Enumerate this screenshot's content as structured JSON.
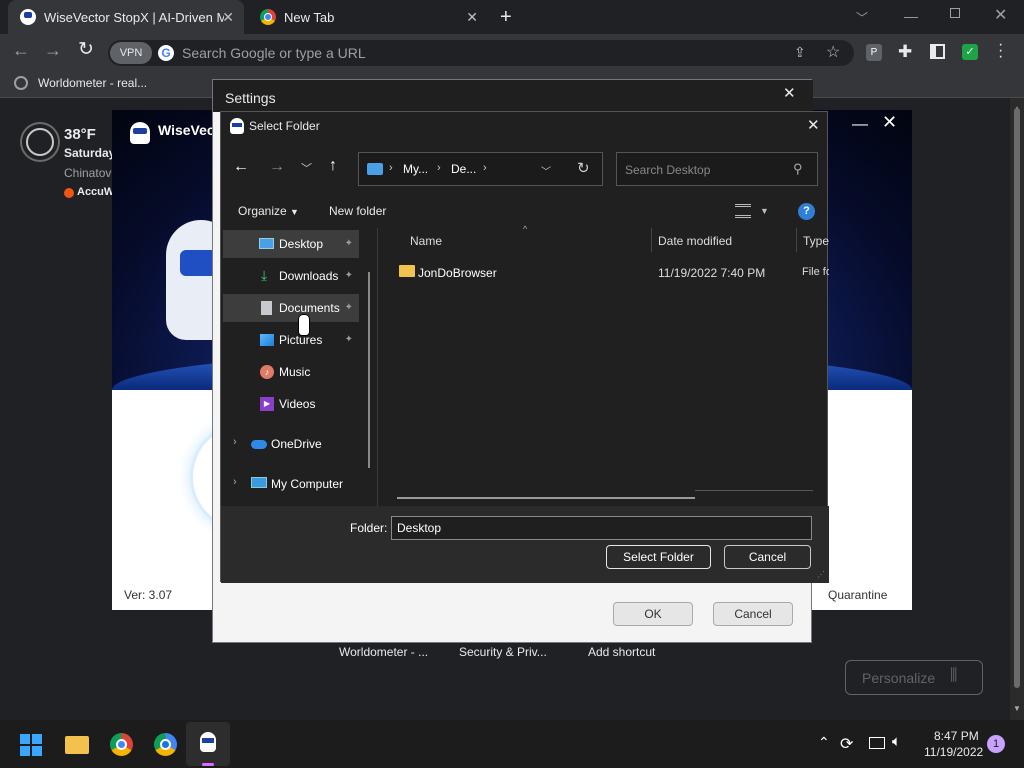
{
  "browser": {
    "tabs": [
      {
        "title": "WiseVector StopX | AI-Driven Ma"
      },
      {
        "title": "New Tab"
      }
    ],
    "address_placeholder": "Search Google or type a URL",
    "vpn_label": "VPN",
    "bookmark": "Worldometer - real..."
  },
  "weather": {
    "temp": "38°F",
    "day": "Saturday",
    "location": "Chinatov",
    "provider": "AccuW"
  },
  "wisevector": {
    "title": "WiseVec",
    "version": "Ver: 3.07",
    "quarantine": "Quarantine"
  },
  "settings": {
    "title": "Settings",
    "ok": "OK",
    "cancel": "Cancel"
  },
  "shortcuts": [
    "Worldometer - ...",
    "Security & Priv...",
    "Add shortcut"
  ],
  "personalize": "Personalize",
  "dialog": {
    "title": "Select Folder",
    "breadcrumb": [
      "My...",
      "De..."
    ],
    "search_placeholder": "Search Desktop",
    "organize": "Organize",
    "new_folder": "New folder",
    "nav": [
      {
        "label": "Desktop",
        "pinned": true
      },
      {
        "label": "Downloads",
        "pinned": true
      },
      {
        "label": "Documents",
        "pinned": true
      },
      {
        "label": "Pictures",
        "pinned": true
      },
      {
        "label": "Music",
        "pinned": false
      },
      {
        "label": "Videos",
        "pinned": false
      },
      {
        "label": "OneDrive",
        "pinned": false
      },
      {
        "label": "My Computer",
        "pinned": false
      }
    ],
    "columns": [
      "Name",
      "Date modified",
      "Type"
    ],
    "files": [
      {
        "name": "JonDoBrowser",
        "date": "11/19/2022 7:40 PM",
        "type": "File fo"
      }
    ],
    "folder_label": "Folder:",
    "folder_value": "Desktop",
    "select_button": "Select Folder",
    "cancel_button": "Cancel"
  },
  "taskbar": {
    "time": "8:47 PM",
    "date": "11/19/2022",
    "notifications": "1"
  }
}
